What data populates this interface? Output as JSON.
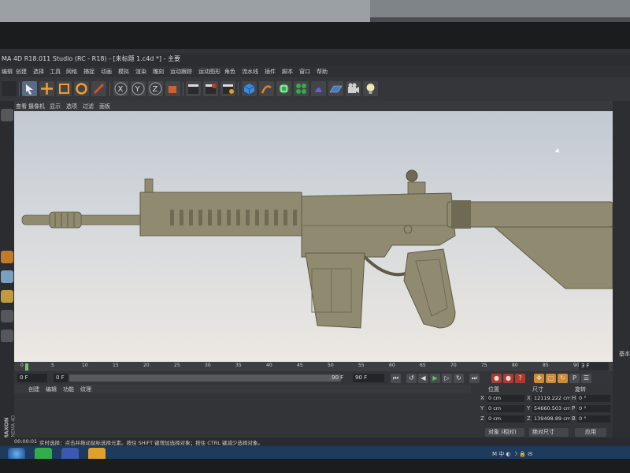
{
  "window": {
    "title": "MA 4D R18.011 Studio (RC - R18) - [未标题 1.c4d *] - 主要"
  },
  "menubar": {
    "items": [
      "编辑",
      "创建",
      "选择",
      "工具",
      "网格",
      "捕捉",
      "动画",
      "模拟",
      "渲染",
      "雕刻",
      "运动跟踪",
      "运动图形",
      "角色",
      "流水线",
      "插件",
      "脚本",
      "窗口",
      "帮助"
    ]
  },
  "viewport_menu": {
    "items": [
      "查看",
      "摄像机",
      "显示",
      "选项",
      "过滤",
      "面板"
    ]
  },
  "timeline": {
    "ticks": [
      "0",
      "5",
      "10",
      "15",
      "20",
      "25",
      "30",
      "35",
      "40",
      "45",
      "50",
      "55",
      "60",
      "65",
      "70",
      "75",
      "80",
      "85",
      "90"
    ],
    "end_frame": "3 F",
    "playhead_frame": 0
  },
  "transport": {
    "current_frame": "0 F",
    "start_frame": "0 F",
    "slider_end": "90 F",
    "max_frame": "90 F"
  },
  "materials": {
    "menu": [
      "创建",
      "编辑",
      "功能",
      "纹理"
    ],
    "brand": "MAXON",
    "product": "CINEMA 4D"
  },
  "coordinates": {
    "headers": [
      "位置",
      "尺寸",
      "旋转"
    ],
    "rows": [
      {
        "axis": "X",
        "position": "0 cm",
        "size_axis": "X",
        "size": "12119.222 cm",
        "rot_axis": "H",
        "rotation": "0 °"
      },
      {
        "axis": "Y",
        "position": "0 cm",
        "size_axis": "Y",
        "size": "54660.503 cm",
        "rot_axis": "P",
        "rotation": "0 °"
      },
      {
        "axis": "Z",
        "position": "0 cm",
        "size_axis": "Z",
        "size": "139498.89 cm",
        "rot_axis": "B",
        "rotation": "0 °"
      }
    ],
    "mode_select": "对象 (相对)",
    "size_select": "绝对尺寸",
    "apply_button": "应用"
  },
  "right_panel": {
    "label": "基本"
  },
  "status": {
    "time": "00:00:01",
    "message": "实时选择：点击并拖动鼠标选择元素。按住 SHIFT 键增加选择对象；按住 CTRL 键减少选择对象。"
  },
  "taskbar": {
    "tray_text": "M 中 ◐ ☽ 🔒 ✉"
  },
  "colors": {
    "model": "#8f8a70",
    "model_dark": "#6f6a54",
    "viewport_top": "#c2c9d2",
    "viewport_bottom": "#ece8e2",
    "accent_red": "#c0392b",
    "playhead": "#66cc66"
  }
}
